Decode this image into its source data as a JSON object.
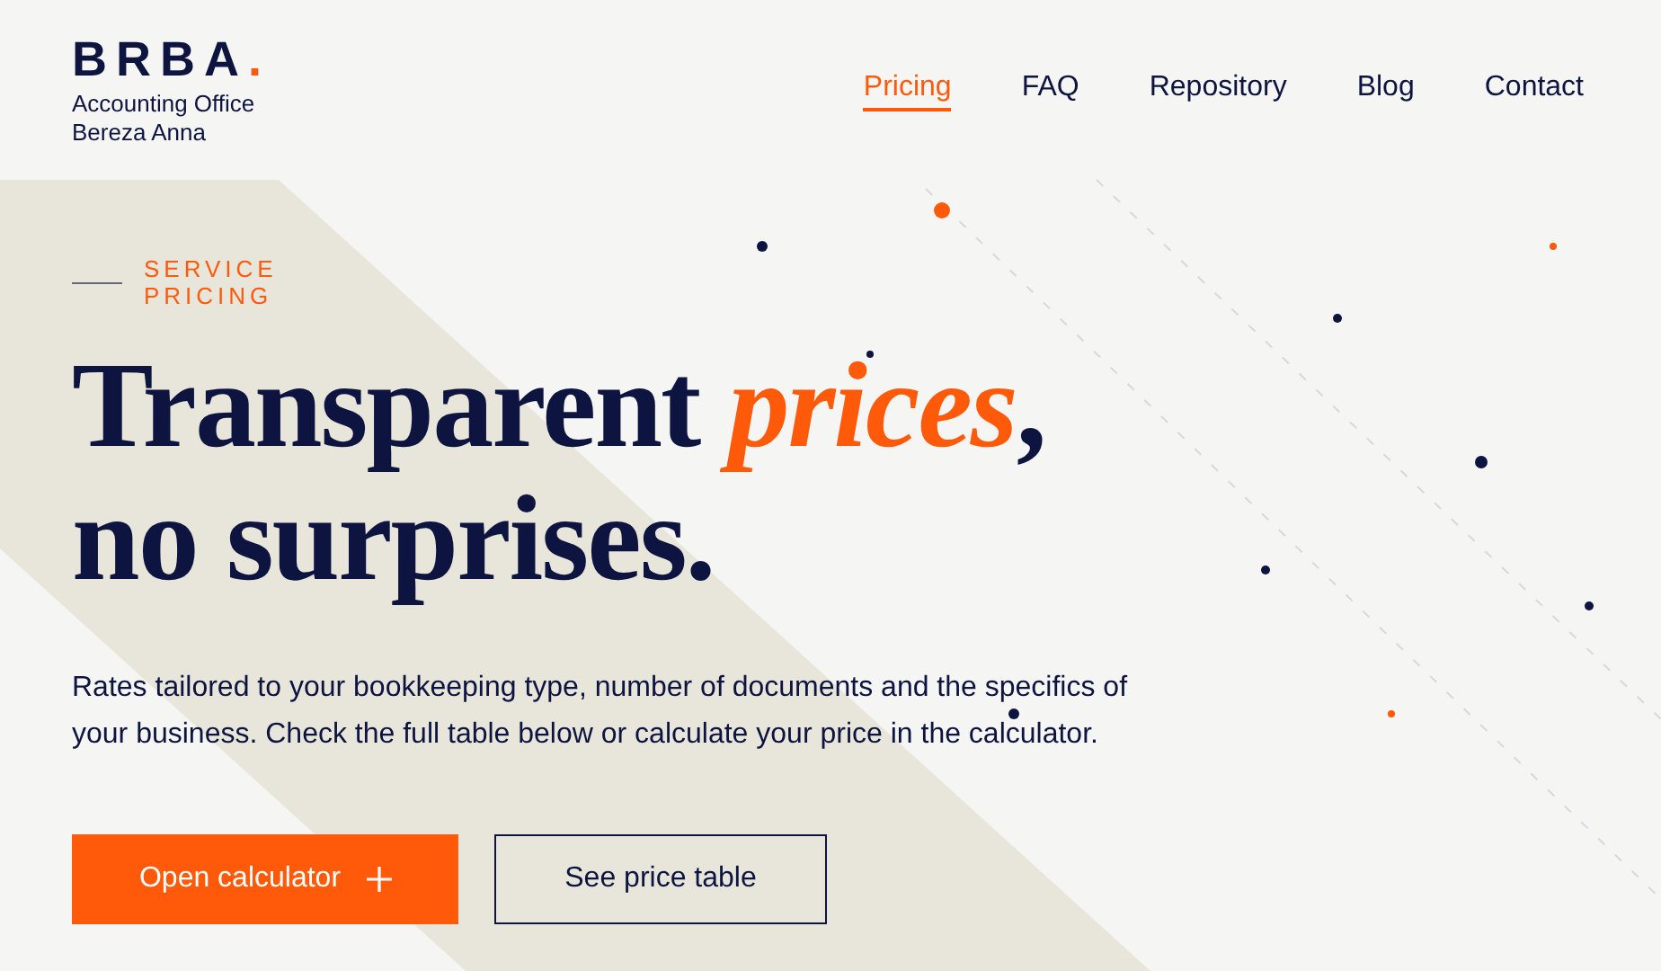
{
  "logo": {
    "name": "BRBA",
    "mark": ".",
    "subtitle_lines": [
      "Accounting Office",
      "Bereza Anna"
    ]
  },
  "nav": [
    {
      "label": "Pricing",
      "selected": true
    },
    {
      "label": "FAQ",
      "selected": false
    },
    {
      "label": "Repository",
      "selected": false
    },
    {
      "label": "Blog",
      "selected": false
    },
    {
      "label": "Contact",
      "selected": false
    }
  ],
  "hero": {
    "eyebrow_lines": [
      "SERVICE",
      "PRICING"
    ],
    "headline_lines": [
      "Transparent *prices*,",
      "no surprises."
    ],
    "lead": "Rates tailored to your bookkeeping type, number of documents and the specifics of your business. Check the full table below or calculate your price in the calculator.",
    "buttons": [
      {
        "kind": "primary",
        "label": "Open calculator"
      },
      {
        "kind": "outline",
        "label": "See price table"
      }
    ]
  }
}
